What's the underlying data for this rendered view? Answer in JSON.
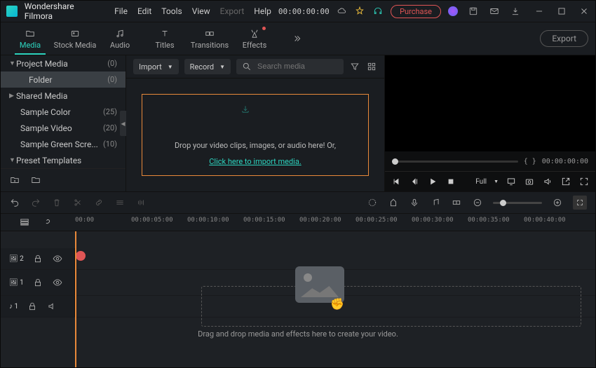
{
  "app_name": "Wondershare Filmora",
  "menu": [
    "File",
    "Edit",
    "Tools",
    "View",
    "Export",
    "Help"
  ],
  "title_timecode": "00:00:00:00",
  "purchase_label": "Purchase",
  "tabs": [
    {
      "label": "Media",
      "icon": "media"
    },
    {
      "label": "Stock Media",
      "icon": "stock"
    },
    {
      "label": "Audio",
      "icon": "audio"
    },
    {
      "label": "Titles",
      "icon": "titles"
    },
    {
      "label": "Transitions",
      "icon": "transitions"
    },
    {
      "label": "Effects",
      "icon": "effects",
      "dot": true
    }
  ],
  "export_label": "Export",
  "side": [
    {
      "label": "Project Media",
      "count": "(0)",
      "chev": "down",
      "sel": false
    },
    {
      "label": "Folder",
      "count": "(0)",
      "child": true,
      "sel": true
    },
    {
      "label": "Shared Media",
      "count": "",
      "chev": "right",
      "sel": false
    },
    {
      "label": "Sample Color",
      "count": "(25)",
      "child": true
    },
    {
      "label": "Sample Video",
      "count": "(20)",
      "child": true
    },
    {
      "label": "Sample Green Scre...",
      "count": "(10)",
      "child": true
    },
    {
      "label": "Preset Templates",
      "count": "",
      "chev": "down"
    }
  ],
  "import_label": "Import",
  "record_label": "Record",
  "search_placeholder": "Search media",
  "drop_text": "Drop your video clips, images, or audio here! Or,",
  "drop_link": "Click here to import media.",
  "preview_time_left": "{     }",
  "preview_time_right": "00:00:00:00",
  "preview_quality": "Full",
  "ruler_ticks": [
    "00:00",
    "00:00:05:00",
    "00:00:10:00",
    "00:00:15:00",
    "00:00:20:00",
    "00:00:25:00",
    "00:00:30:00",
    "00:00:35:00",
    "00:00:40:00"
  ],
  "tracks": [
    {
      "name": "🖼 2"
    },
    {
      "name": "🖼 1"
    },
    {
      "name": "♪ 1"
    }
  ],
  "timeline_hint": "Drag and drop media and effects here to create your video."
}
